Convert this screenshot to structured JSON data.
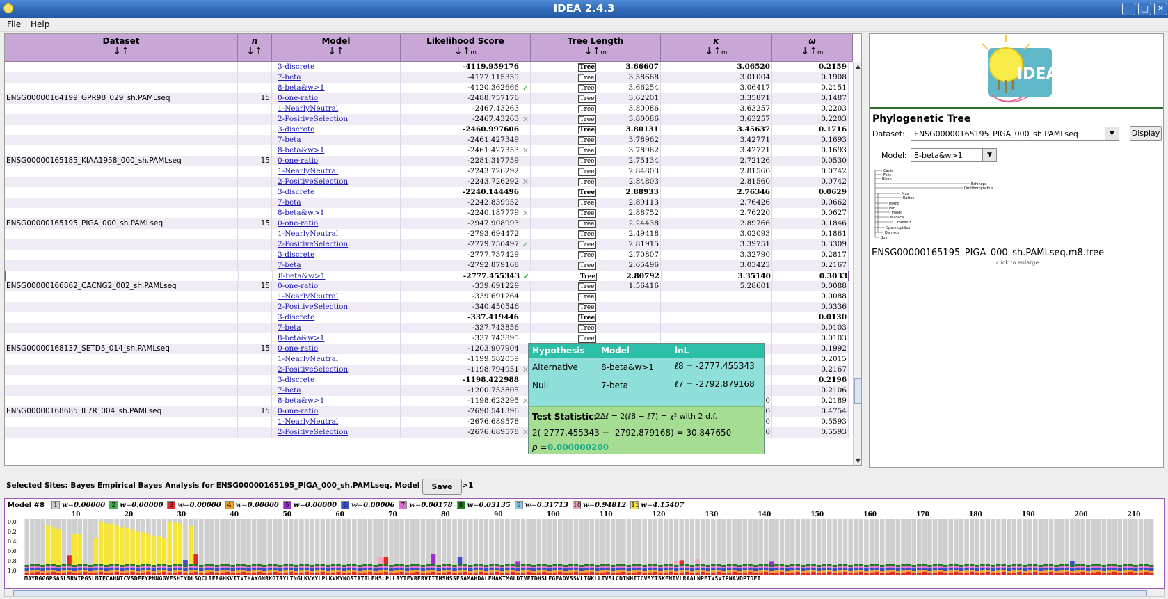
{
  "window": {
    "title": "IDEA 2.4.3",
    "controls": [
      "_",
      "□",
      "✕"
    ]
  },
  "menu": {
    "items": [
      "File",
      "Help"
    ]
  },
  "table": {
    "headers": {
      "dataset": "Dataset",
      "n": "n",
      "model": "Model",
      "likelihood": "Likelihood Score",
      "tree_length": "Tree Length",
      "kappa": "κ",
      "omega": "ω"
    },
    "sort_icons": {
      "dataset": "↓↑",
      "n": "↓↑",
      "model": "↓↑",
      "likelihood": "↓↑ₘ",
      "tree_length": "↓↑ₘ",
      "kappa": "↓↑ₘ",
      "omega": "↓↑ₘ"
    },
    "tree_button": "Tree",
    "rows": [
      {
        "ds": "",
        "n": "",
        "model": "3-discrete",
        "lnl": "-4119.959176",
        "mark": "",
        "tl": "3.66607",
        "k": "3.06520",
        "w": "0.2159",
        "bold": true
      },
      {
        "ds": "",
        "n": "",
        "model": "7-beta",
        "lnl": "-4127.115359",
        "mark": "",
        "tl": "3.58668",
        "k": "3.01004",
        "w": "0.1908",
        "bold": false
      },
      {
        "ds": "",
        "n": "",
        "model": "8-beta&w>1",
        "lnl": "-4120.362666",
        "mark": "✓",
        "tl": "3.66254",
        "k": "3.06417",
        "w": "0.2151",
        "bold": false
      },
      {
        "ds": "ENSG00000164199_GPR98_029_sh.PAMLseq",
        "n": "15",
        "model": "0-one-ratio",
        "lnl": "-2488.757176",
        "mark": "",
        "tl": "3.62201",
        "k": "3.35871",
        "w": "0.1487",
        "bold": false
      },
      {
        "ds": "",
        "n": "",
        "model": "1-NearlyNeutral",
        "lnl": "-2467.43263",
        "mark": "",
        "tl": "3.80086",
        "k": "3.63257",
        "w": "0.2203",
        "bold": false
      },
      {
        "ds": "",
        "n": "",
        "model": "2-PositiveSelection",
        "lnl": "-2467.43263",
        "mark": "✕",
        "tl": "3.80086",
        "k": "3.63257",
        "w": "0.2203",
        "bold": false
      },
      {
        "ds": "",
        "n": "",
        "model": "3-discrete",
        "lnl": "-2460.997606",
        "mark": "",
        "tl": "3.80131",
        "k": "3.45637",
        "w": "0.1716",
        "bold": true
      },
      {
        "ds": "",
        "n": "",
        "model": "7-beta",
        "lnl": "-2461.427349",
        "mark": "",
        "tl": "3.78962",
        "k": "3.42771",
        "w": "0.1693",
        "bold": false
      },
      {
        "ds": "",
        "n": "",
        "model": "8-beta&w>1",
        "lnl": "-2461.427353",
        "mark": "✕",
        "tl": "3.78962",
        "k": "3.42771",
        "w": "0.1693",
        "bold": false
      },
      {
        "ds": "ENSG00000165185_KIAA1958_000_sh.PAMLseq",
        "n": "15",
        "model": "0-one-ratio",
        "lnl": "-2281.317759",
        "mark": "",
        "tl": "2.75134",
        "k": "2.72126",
        "w": "0.0530",
        "bold": false
      },
      {
        "ds": "",
        "n": "",
        "model": "1-NearlyNeutral",
        "lnl": "-2243.726292",
        "mark": "",
        "tl": "2.84803",
        "k": "2.81560",
        "w": "0.0742",
        "bold": false
      },
      {
        "ds": "",
        "n": "",
        "model": "2-PositiveSelection",
        "lnl": "-2243.726292",
        "mark": "✕",
        "tl": "2.84803",
        "k": "2.81560",
        "w": "0.0742",
        "bold": false
      },
      {
        "ds": "",
        "n": "",
        "model": "3-discrete",
        "lnl": "-2240.144496",
        "mark": "",
        "tl": "2.88933",
        "k": "2.76346",
        "w": "0.0629",
        "bold": true
      },
      {
        "ds": "",
        "n": "",
        "model": "7-beta",
        "lnl": "-2242.839952",
        "mark": "",
        "tl": "2.89113",
        "k": "2.76426",
        "w": "0.0662",
        "bold": false
      },
      {
        "ds": "",
        "n": "",
        "model": "8-beta&w>1",
        "lnl": "-2240.187779",
        "mark": "✕",
        "tl": "2.88752",
        "k": "2.76220",
        "w": "0.0627",
        "bold": false
      },
      {
        "ds": "ENSG00000165195_PIGA_000_sh.PAMLseq",
        "n": "15",
        "model": "0-one-ratio",
        "lnl": "-2947.908993",
        "mark": "",
        "tl": "2.24438",
        "k": "2.89766",
        "w": "0.1846",
        "bold": false
      },
      {
        "ds": "",
        "n": "",
        "model": "1-NearlyNeutral",
        "lnl": "-2793.694472",
        "mark": "",
        "tl": "2.49418",
        "k": "3.02093",
        "w": "0.1861",
        "bold": false
      },
      {
        "ds": "",
        "n": "",
        "model": "2-PositiveSelection",
        "lnl": "-2779.750497",
        "mark": "✓",
        "tl": "2.81915",
        "k": "3.39751",
        "w": "0.3309",
        "bold": false
      },
      {
        "ds": "",
        "n": "",
        "model": "3-discrete",
        "lnl": "-2777.737429",
        "mark": "",
        "tl": "2.70807",
        "k": "3.32790",
        "w": "0.2817",
        "bold": false
      },
      {
        "ds": "",
        "n": "",
        "model": "7-beta",
        "lnl": "-2792.879168",
        "mark": "",
        "tl": "2.65496",
        "k": "3.03423",
        "w": "0.2167",
        "bold": false
      },
      {
        "ds": "",
        "n": "",
        "model": "8-beta&w>1",
        "lnl": "-2777.455343",
        "mark": "✓",
        "tl": "2.80792",
        "k": "3.35140",
        "w": "0.3033",
        "bold": true,
        "selected": true
      },
      {
        "ds": "ENSG00000166862_CACNG2_002_sh.PAMLseq",
        "n": "15",
        "model": "0-one-ratio",
        "lnl": "-339.691229",
        "mark": "",
        "tl": "1.56416",
        "k": "5.28601",
        "w": "0.0088",
        "bold": false
      },
      {
        "ds": "",
        "n": "",
        "model": "1-NearlyNeutral",
        "lnl": "-339.691264",
        "mark": "",
        "tl": "",
        "k": "",
        "w": "0.0088",
        "bold": false
      },
      {
        "ds": "",
        "n": "",
        "model": "2-PositiveSelection",
        "lnl": "-340.450546",
        "mark": "",
        "tl": "",
        "k": "",
        "w": "0.0336",
        "bold": false
      },
      {
        "ds": "",
        "n": "",
        "model": "3-discrete",
        "lnl": "-337.419446",
        "mark": "",
        "tl": "",
        "k": "",
        "w": "0.0130",
        "bold": true
      },
      {
        "ds": "",
        "n": "",
        "model": "7-beta",
        "lnl": "-337.743856",
        "mark": "",
        "tl": "",
        "k": "",
        "w": "0.0103",
        "bold": false
      },
      {
        "ds": "",
        "n": "",
        "model": "8-beta&w>1",
        "lnl": "-337.743895",
        "mark": "",
        "tl": "",
        "k": "",
        "w": "0.0103",
        "bold": false
      },
      {
        "ds": "ENSG00000168137_SETD5_014_sh.PAMLseq",
        "n": "15",
        "model": "0-one-ratio",
        "lnl": "-1203.907904",
        "mark": "",
        "tl": "",
        "k": "",
        "w": "0.1992",
        "bold": false
      },
      {
        "ds": "",
        "n": "",
        "model": "1-NearlyNeutral",
        "lnl": "-1199.582059",
        "mark": "",
        "tl": "",
        "k": "",
        "w": "0.2015",
        "bold": false
      },
      {
        "ds": "",
        "n": "",
        "model": "2-PositiveSelection",
        "lnl": "-1198.794951",
        "mark": "✕",
        "tl": "",
        "k": "",
        "w": "0.2167",
        "bold": false
      },
      {
        "ds": "",
        "n": "",
        "model": "3-discrete",
        "lnl": "-1198.422988",
        "mark": "",
        "tl": "",
        "k": "",
        "w": "0.2196",
        "bold": true
      },
      {
        "ds": "",
        "n": "",
        "model": "7-beta",
        "lnl": "-1200.753805",
        "mark": "",
        "tl": "",
        "k": "",
        "w": "0.2106",
        "bold": false
      },
      {
        "ds": "",
        "n": "",
        "model": "8-beta&w>1",
        "lnl": "-1198.623295",
        "mark": "✕",
        "tl": "2.70447",
        "k": "5.67450",
        "w": "0.2189",
        "bold": false
      },
      {
        "ds": "ENSG00000168685_IL7R_004_sh.PAMLseq",
        "n": "15",
        "model": "0-one-ratio",
        "lnl": "-2690.541396",
        "mark": "",
        "tl": "6.68086",
        "k": "3.14250",
        "w": "0.4754",
        "bold": false
      },
      {
        "ds": "",
        "n": "",
        "model": "1-NearlyNeutral",
        "lnl": "-2676.689578",
        "mark": "",
        "tl": "7.04734",
        "k": "3.30330",
        "w": "0.5593",
        "bold": false
      },
      {
        "ds": "",
        "n": "",
        "model": "2-PositiveSelection",
        "lnl": "-2676.689578",
        "mark": "✕",
        "tl": "7.04734",
        "k": "3.30330",
        "w": "0.5593",
        "bold": false
      }
    ]
  },
  "popup": {
    "headers": [
      "Hypothesis",
      "Model",
      "lnL"
    ],
    "alt": {
      "label": "Alternative",
      "model": "8-beta&w>1",
      "lnl": "ℓ8 = -2777.455343"
    },
    "null": {
      "label": "Null",
      "model": "7-beta",
      "lnl": "ℓ7 = -2792.879168"
    },
    "test_label": "Test Statistic:",
    "test_formula": "2Δℓ = 2(ℓ8 − ℓ7) = χ² with 2 d.f.",
    "test_value": "2(-2777.455343 − -2792.879168) = 30.847650",
    "p_label": "p = ",
    "p_value": "0.000000200"
  },
  "tree_panel": {
    "logo_text": "IDEA",
    "title": "Phylogenetic Tree",
    "dataset_label": "Dataset:",
    "dataset_value": "ENSG00000165195_PIGA_000_sh.PAMLseq",
    "display_button": "Display",
    "model_label": "Model:",
    "model_value": "8-beta&w>1",
    "taxa": [
      "Canis",
      "Felis",
      "Bison",
      "Echinops",
      "Ornithorhynchus",
      "Mus",
      "Rattus",
      "Homo",
      "Pan",
      "Pongo",
      "Macaca",
      "Otolemur",
      "Spermophilus",
      "Danyrus",
      "Bos"
    ],
    "caption": "ENSG00000165195_PIGA_000_sh.PAMLseq.m8.tree",
    "hint": "click to enlarge"
  },
  "selected_sites": {
    "text": "Selected Sites:  Bayes Empirical Bayes Analysis for  ENSG00000165195_PIGA_000_sh.PAMLseq, Model 8-beta&w>1",
    "save_label": "Save"
  },
  "bottom": {
    "model_label": "Model #8",
    "classes": [
      {
        "n": "1",
        "w": "w=0.00000",
        "color": "#cfcfcf"
      },
      {
        "n": "2",
        "w": "w=0.00000",
        "color": "#3fb24f"
      },
      {
        "n": "3",
        "w": "w=0.00000",
        "color": "#e02a2a"
      },
      {
        "n": "4",
        "w": "w=0.00000",
        "color": "#f0a030"
      },
      {
        "n": "5",
        "w": "w=0.00000",
        "color": "#9a2fd6"
      },
      {
        "n": "6",
        "w": "w=0.00006",
        "color": "#3a4fc7"
      },
      {
        "n": "7",
        "w": "w=0.00178",
        "color": "#e36fd8"
      },
      {
        "n": "8",
        "w": "w=0.03135",
        "color": "#1e7a1e"
      },
      {
        "n": "9",
        "w": "w=0.31713",
        "color": "#8cc8ea"
      },
      {
        "n": "10",
        "w": "w=0.94812",
        "color": "#f0a8c0"
      },
      {
        "n": "11",
        "w": "w=4.15407",
        "color": "#f7e63a"
      }
    ],
    "axis_ticks": [
      "10",
      "20",
      "30",
      "40",
      "50",
      "60",
      "70",
      "80",
      "90",
      "100",
      "110",
      "120",
      "130",
      "140",
      "150",
      "160",
      "170",
      "180",
      "190",
      "200",
      "210"
    ],
    "y_ticks": [
      "0.0",
      "0.2",
      "0.4",
      "0.6",
      "0.8",
      "1.0"
    ],
    "sequence": "MAYRGGGPSASLSRVIPGSLNTFCAHNICVSDFFYPNNGGVESHIYDLSQCLIERGHKVIIVTHAYGNRKGIRYLTNGLKVYYLPLKVMYNQSTATTLFHSLPLLRYIFVRERVTIIHSHSSFSAMAHDALFHAKTMGLDTVFTDHSLFGFADVSSVLTNKLLTVSLCDTNHIICVSYTSKENTVLRAALNPEIVSVIPNAVDPTDFT"
  }
}
